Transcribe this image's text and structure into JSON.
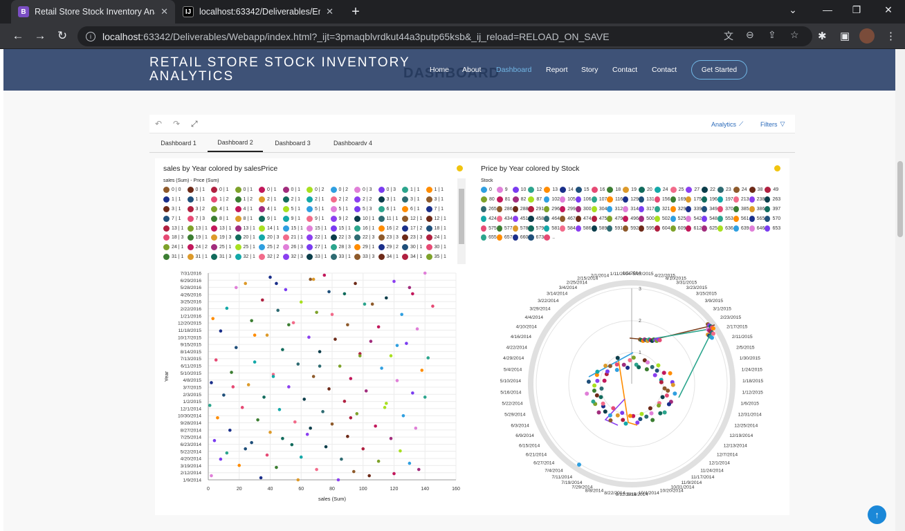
{
  "browser": {
    "tabs": [
      {
        "title": "Retail Store Stock Inventory Analy",
        "icon": "bootstrap-icon",
        "fav_text": "B",
        "fav_color": "#7b4ec4"
      },
      {
        "title": "localhost:63342/Deliverables/Em",
        "icon": "intellij-icon",
        "fav_text": "IJ",
        "fav_color": "#000000"
      }
    ],
    "url_host": "localhost",
    "url_rest": ":63342/Deliverables/Webapp/index.html?_ijt=3pmaqblvrdkut44a3putp65ksb&_ij_reload=RELOAD_ON_SAVE"
  },
  "site": {
    "brand_line1": "RETAIL STORE STOCK INVENTORY",
    "brand_line2": "ANALYTICS",
    "ghost_text": "DASHBOARD",
    "nav": [
      "Home",
      "About",
      "Dashboard",
      "Report",
      "Story",
      "Contact",
      "Contact"
    ],
    "active_nav": "Dashboard",
    "cta": "Get Started"
  },
  "toolbar": {
    "analytics": "Analytics",
    "filters": "Filters"
  },
  "dashboard_tabs": [
    "Dashboard 1",
    "Dashboard 2",
    "Dashboard 3",
    "Dashboardv 4"
  ],
  "active_dashboard_tab": "Dashboard 2",
  "colors": {
    "accent": "#71b7e6",
    "navbar": "#3e5277",
    "warn": "#f1c40f",
    "fab": "#1b88d8"
  },
  "palette": [
    "#8e5a2b",
    "#2ca58d",
    "#8b3ff0",
    "#2f9fe0",
    "#116b5c",
    "#c2185b",
    "#e64a74",
    "#6d2a18",
    "#ff8c00",
    "#0b3d4a",
    "#e07fd8",
    "#13a8a8",
    "#a12d7d",
    "#3c7e32",
    "#b02040",
    "#1a2f8a",
    "#2e6b72",
    "#7a3cf0",
    "#f26b8a",
    "#a8e020",
    "#dd9a2a",
    "#7ea22a",
    "#1f4f7a"
  ],
  "chart_data": [
    {
      "type": "scatter",
      "title": "sales by Year colored by salesPrice",
      "legend_title": "sales (Sum) - Price (Sum)",
      "legend_entries": [
        "0 | 0",
        "0 | 1",
        "0 | 1",
        "0 | 1",
        "0 | 1",
        "0 | 1",
        "0 | 2",
        "0 | 2",
        "0 | 3",
        "0 | 3",
        "1 | 1",
        "1 | 1",
        "1 | 1",
        "1 | 1",
        "1 | 2",
        "1 | 2",
        "2 | 1",
        "2 | 1",
        "2 | 1",
        "2 | 2",
        "2 | 2",
        "3 | 1",
        "3 | 1",
        "3 | 1",
        "3 | 1",
        "3 | 2",
        "4 | 1",
        "4 | 1",
        "4 | 1",
        "5 | 1",
        "5 | 1",
        "5 | 1",
        "5 | 3",
        "6 | 1",
        "6 | 1",
        "7 | 1",
        "7 | 1",
        "7 | 3",
        "8 | 1",
        "8 | 1",
        "9 | 1",
        "9 | 1",
        "9 | 1",
        "9 | 2",
        "10 | 1",
        "11 | 1",
        "12 | 1",
        "12 | 1",
        "13 | 1",
        "13 | 1",
        "13 | 1",
        "13 | 1",
        "14 | 1",
        "15 | 1",
        "15 | 1",
        "15 | 1",
        "16 | 1",
        "16 | 2",
        "17 | 2",
        "18 | 1",
        "18 | 3",
        "19 | 1",
        "19 | 3",
        "20 | 1",
        "20 | 3",
        "21 | 1",
        "22 | 1",
        "22 | 3",
        "22 | 3",
        "23 | 3",
        "23 | 3",
        "24 | 1",
        "24 | 1",
        "24 | 2",
        "25 | 1",
        "25 | 1",
        "25 | 2",
        "26 | 3",
        "27 | 1",
        "28 | 3",
        "29 | 1",
        "29 | 2",
        "30 | 1",
        "30 | 1",
        "31 | 1",
        "31 | 1",
        "31 | 3",
        "32 | 1",
        "32 | 2",
        "32 | 3",
        "33 | 1",
        "33 | 1",
        "33 | 3",
        "34 | 1",
        "34 | 1",
        "35 | 1",
        "35 | 1"
      ],
      "xlabel": "sales (Sum)",
      "ylabel": "Year",
      "xlim": [
        0,
        160
      ],
      "x_ticks": [
        0,
        20,
        40,
        60,
        80,
        100,
        120,
        140,
        160
      ],
      "y_ticks": [
        "7/31/2016",
        "6/29/2016",
        "5/28/2016",
        "4/26/2016",
        "3/25/2016",
        "2/22/2016",
        "1/21/2016",
        "12/20/2015",
        "11/18/2015",
        "10/17/2015",
        "9/15/2015",
        "8/14/2015",
        "7/13/2015",
        "6/11/2015",
        "5/10/2015",
        "4/8/2015",
        "3/7/2015",
        "2/3/2015",
        "1/2/2015",
        "12/1/2014",
        "10/30/2014",
        "9/28/2014",
        "8/27/2014",
        "7/25/2014",
        "6/23/2014",
        "5/22/2014",
        "4/20/2014",
        "3/19/2014",
        "2/12/2014",
        "1/9/2014"
      ],
      "points": [
        [
          66,
          0.97
        ],
        [
          75,
          0.99
        ],
        [
          140,
          1.0
        ],
        [
          40,
          0.98
        ],
        [
          24,
          0.95
        ],
        [
          120,
          0.96
        ],
        [
          95,
          0.95
        ],
        [
          130,
          0.93
        ],
        [
          50,
          0.92
        ],
        [
          78,
          0.91
        ],
        [
          88,
          0.9
        ],
        [
          115,
          0.88
        ],
        [
          35,
          0.87
        ],
        [
          60,
          0.86
        ],
        [
          101,
          0.85
        ],
        [
          145,
          0.84
        ],
        [
          12,
          0.83
        ],
        [
          45,
          0.82
        ],
        [
          70,
          0.81
        ],
        [
          125,
          0.8
        ],
        [
          3,
          0.78
        ],
        [
          28,
          0.77
        ],
        [
          55,
          0.76
        ],
        [
          90,
          0.75
        ],
        [
          110,
          0.74
        ],
        [
          135,
          0.73
        ],
        [
          8,
          0.72
        ],
        [
          38,
          0.7
        ],
        [
          65,
          0.69
        ],
        [
          82,
          0.68
        ],
        [
          105,
          0.67
        ],
        [
          128,
          0.66
        ],
        [
          18,
          0.64
        ],
        [
          48,
          0.63
        ],
        [
          72,
          0.62
        ],
        [
          98,
          0.61
        ],
        [
          118,
          0.6
        ],
        [
          142,
          0.59
        ],
        [
          5,
          0.58
        ],
        [
          30,
          0.57
        ],
        [
          58,
          0.56
        ],
        [
          85,
          0.55
        ],
        [
          112,
          0.54
        ],
        [
          138,
          0.53
        ],
        [
          15,
          0.52
        ],
        [
          42,
          0.51
        ],
        [
          68,
          0.5
        ],
        [
          92,
          0.49
        ],
        [
          122,
          0.48
        ],
        [
          2,
          0.47
        ],
        [
          26,
          0.46
        ],
        [
          52,
          0.45
        ],
        [
          78,
          0.44
        ],
        [
          102,
          0.43
        ],
        [
          132,
          0.42
        ],
        [
          10,
          0.41
        ],
        [
          36,
          0.4
        ],
        [
          62,
          0.39
        ],
        [
          88,
          0.38
        ],
        [
          115,
          0.37
        ],
        [
          1,
          0.36
        ],
        [
          22,
          0.35
        ],
        [
          46,
          0.34
        ],
        [
          74,
          0.33
        ],
        [
          96,
          0.32
        ],
        [
          126,
          0.31
        ],
        [
          6,
          0.3
        ],
        [
          32,
          0.29
        ],
        [
          56,
          0.28
        ],
        [
          80,
          0.27
        ],
        [
          108,
          0.26
        ],
        [
          134,
          0.25
        ],
        [
          14,
          0.24
        ],
        [
          40,
          0.23
        ],
        [
          64,
          0.22
        ],
        [
          90,
          0.21
        ],
        [
          118,
          0.2
        ],
        [
          4,
          0.19
        ],
        [
          28,
          0.18
        ],
        [
          54,
          0.17
        ],
        [
          76,
          0.16
        ],
        [
          100,
          0.15
        ],
        [
          124,
          0.14
        ],
        [
          12,
          0.13
        ],
        [
          38,
          0.12
        ],
        [
          60,
          0.11
        ],
        [
          86,
          0.1
        ],
        [
          110,
          0.09
        ],
        [
          130,
          0.08
        ],
        [
          20,
          0.07
        ],
        [
          44,
          0.06
        ],
        [
          70,
          0.05
        ],
        [
          94,
          0.04
        ],
        [
          120,
          0.03
        ],
        [
          2,
          0.02
        ],
        [
          34,
          0.01
        ],
        [
          58,
          0.0
        ],
        [
          84,
          0.0
        ],
        [
          104,
          0.02
        ],
        [
          136,
          0.05
        ],
        [
          8,
          0.1
        ],
        [
          24,
          0.15
        ],
        [
          48,
          0.2
        ],
        [
          66,
          0.25
        ],
        [
          92,
          0.3
        ],
        [
          114,
          0.35
        ],
        [
          140,
          0.4
        ],
        [
          16,
          0.45
        ],
        [
          42,
          0.5
        ],
        [
          72,
          0.55
        ],
        [
          98,
          0.6
        ],
        [
          122,
          0.65
        ],
        [
          30,
          0.7
        ],
        [
          52,
          0.75
        ],
        [
          80,
          0.8
        ],
        [
          106,
          0.85
        ],
        [
          132,
          0.9
        ],
        [
          18,
          0.93
        ],
        [
          44,
          0.95
        ],
        [
          68,
          0.97
        ]
      ]
    },
    {
      "type": "line",
      "subtype": "polar",
      "title": "Price by Year colored by Stock",
      "legend_title": "Stock",
      "legend_entries": [
        "0",
        "9",
        "10",
        "12",
        "13",
        "14",
        "15",
        "16",
        "18",
        "19",
        "20",
        "24",
        "25",
        "27",
        "22",
        "23",
        "24",
        "38",
        "49",
        "80",
        "81",
        "82",
        "87",
        "102",
        "105",
        "106",
        "107",
        "116",
        "129",
        "131",
        "156",
        "169",
        "175",
        "196",
        "197",
        "213",
        "238",
        "263",
        "265",
        "286",
        "288",
        "291",
        "296",
        "299",
        "300",
        "304",
        "312",
        "314",
        "317",
        "321",
        "329",
        "339",
        "349",
        "370",
        "385",
        "386",
        "397",
        "424",
        "434",
        "451",
        "458",
        "464",
        "467",
        "474",
        "475",
        "479",
        "496",
        "500",
        "502",
        "525",
        "542",
        "548",
        "553",
        "561",
        "565",
        "570",
        "575",
        "577",
        "578",
        "579",
        "581",
        "584",
        "586",
        "589",
        "591",
        "592",
        "595",
        "604",
        "609",
        "612",
        "625",
        "636",
        "639",
        "646",
        "653",
        "655",
        "657",
        "660",
        "673",
        ".."
      ],
      "radial_ticks": [
        1,
        2,
        3
      ],
      "angular_ticks": [
        "1/1/2014",
        "5/12/2015",
        "4/22/2015",
        "4/10/2015",
        "3/31/2015",
        "3/23/2015",
        "3/15/2015",
        "3/9/2015",
        "3/1/2015",
        "2/23/2015",
        "2/17/2015",
        "2/11/2015",
        "2/5/2015",
        "1/30/2015",
        "1/24/2015",
        "1/18/2015",
        "1/12/2015",
        "1/6/2015",
        "12/31/2014",
        "12/25/2014",
        "12/19/2014",
        "12/13/2014",
        "12/7/2014",
        "12/1/2014",
        "11/24/2014",
        "11/17/2014",
        "11/9/2014",
        "10/31/2014",
        "10/20/2014",
        "10/4/2014",
        "9/15/2014",
        "9/12/2014",
        "8/22/2014",
        "8/8/2014",
        "7/29/2014",
        "7/19/2014",
        "7/11/2014",
        "7/4/2014",
        "6/27/2014",
        "6/21/2014",
        "6/15/2014",
        "6/9/2014",
        "6/3/2014",
        "5/29/2014",
        "5/22/2014",
        "5/16/2014",
        "5/10/2014",
        "5/4/2014",
        "4/29/2014",
        "4/22/2014",
        "4/16/2014",
        "4/10/2014",
        "4/4/2014",
        "3/29/2014",
        "3/22/2014",
        "3/14/2014",
        "3/4/2014",
        "2/25/2014",
        "2/15/2014",
        "2/1/2014",
        "1/11/2014"
      ]
    }
  ]
}
